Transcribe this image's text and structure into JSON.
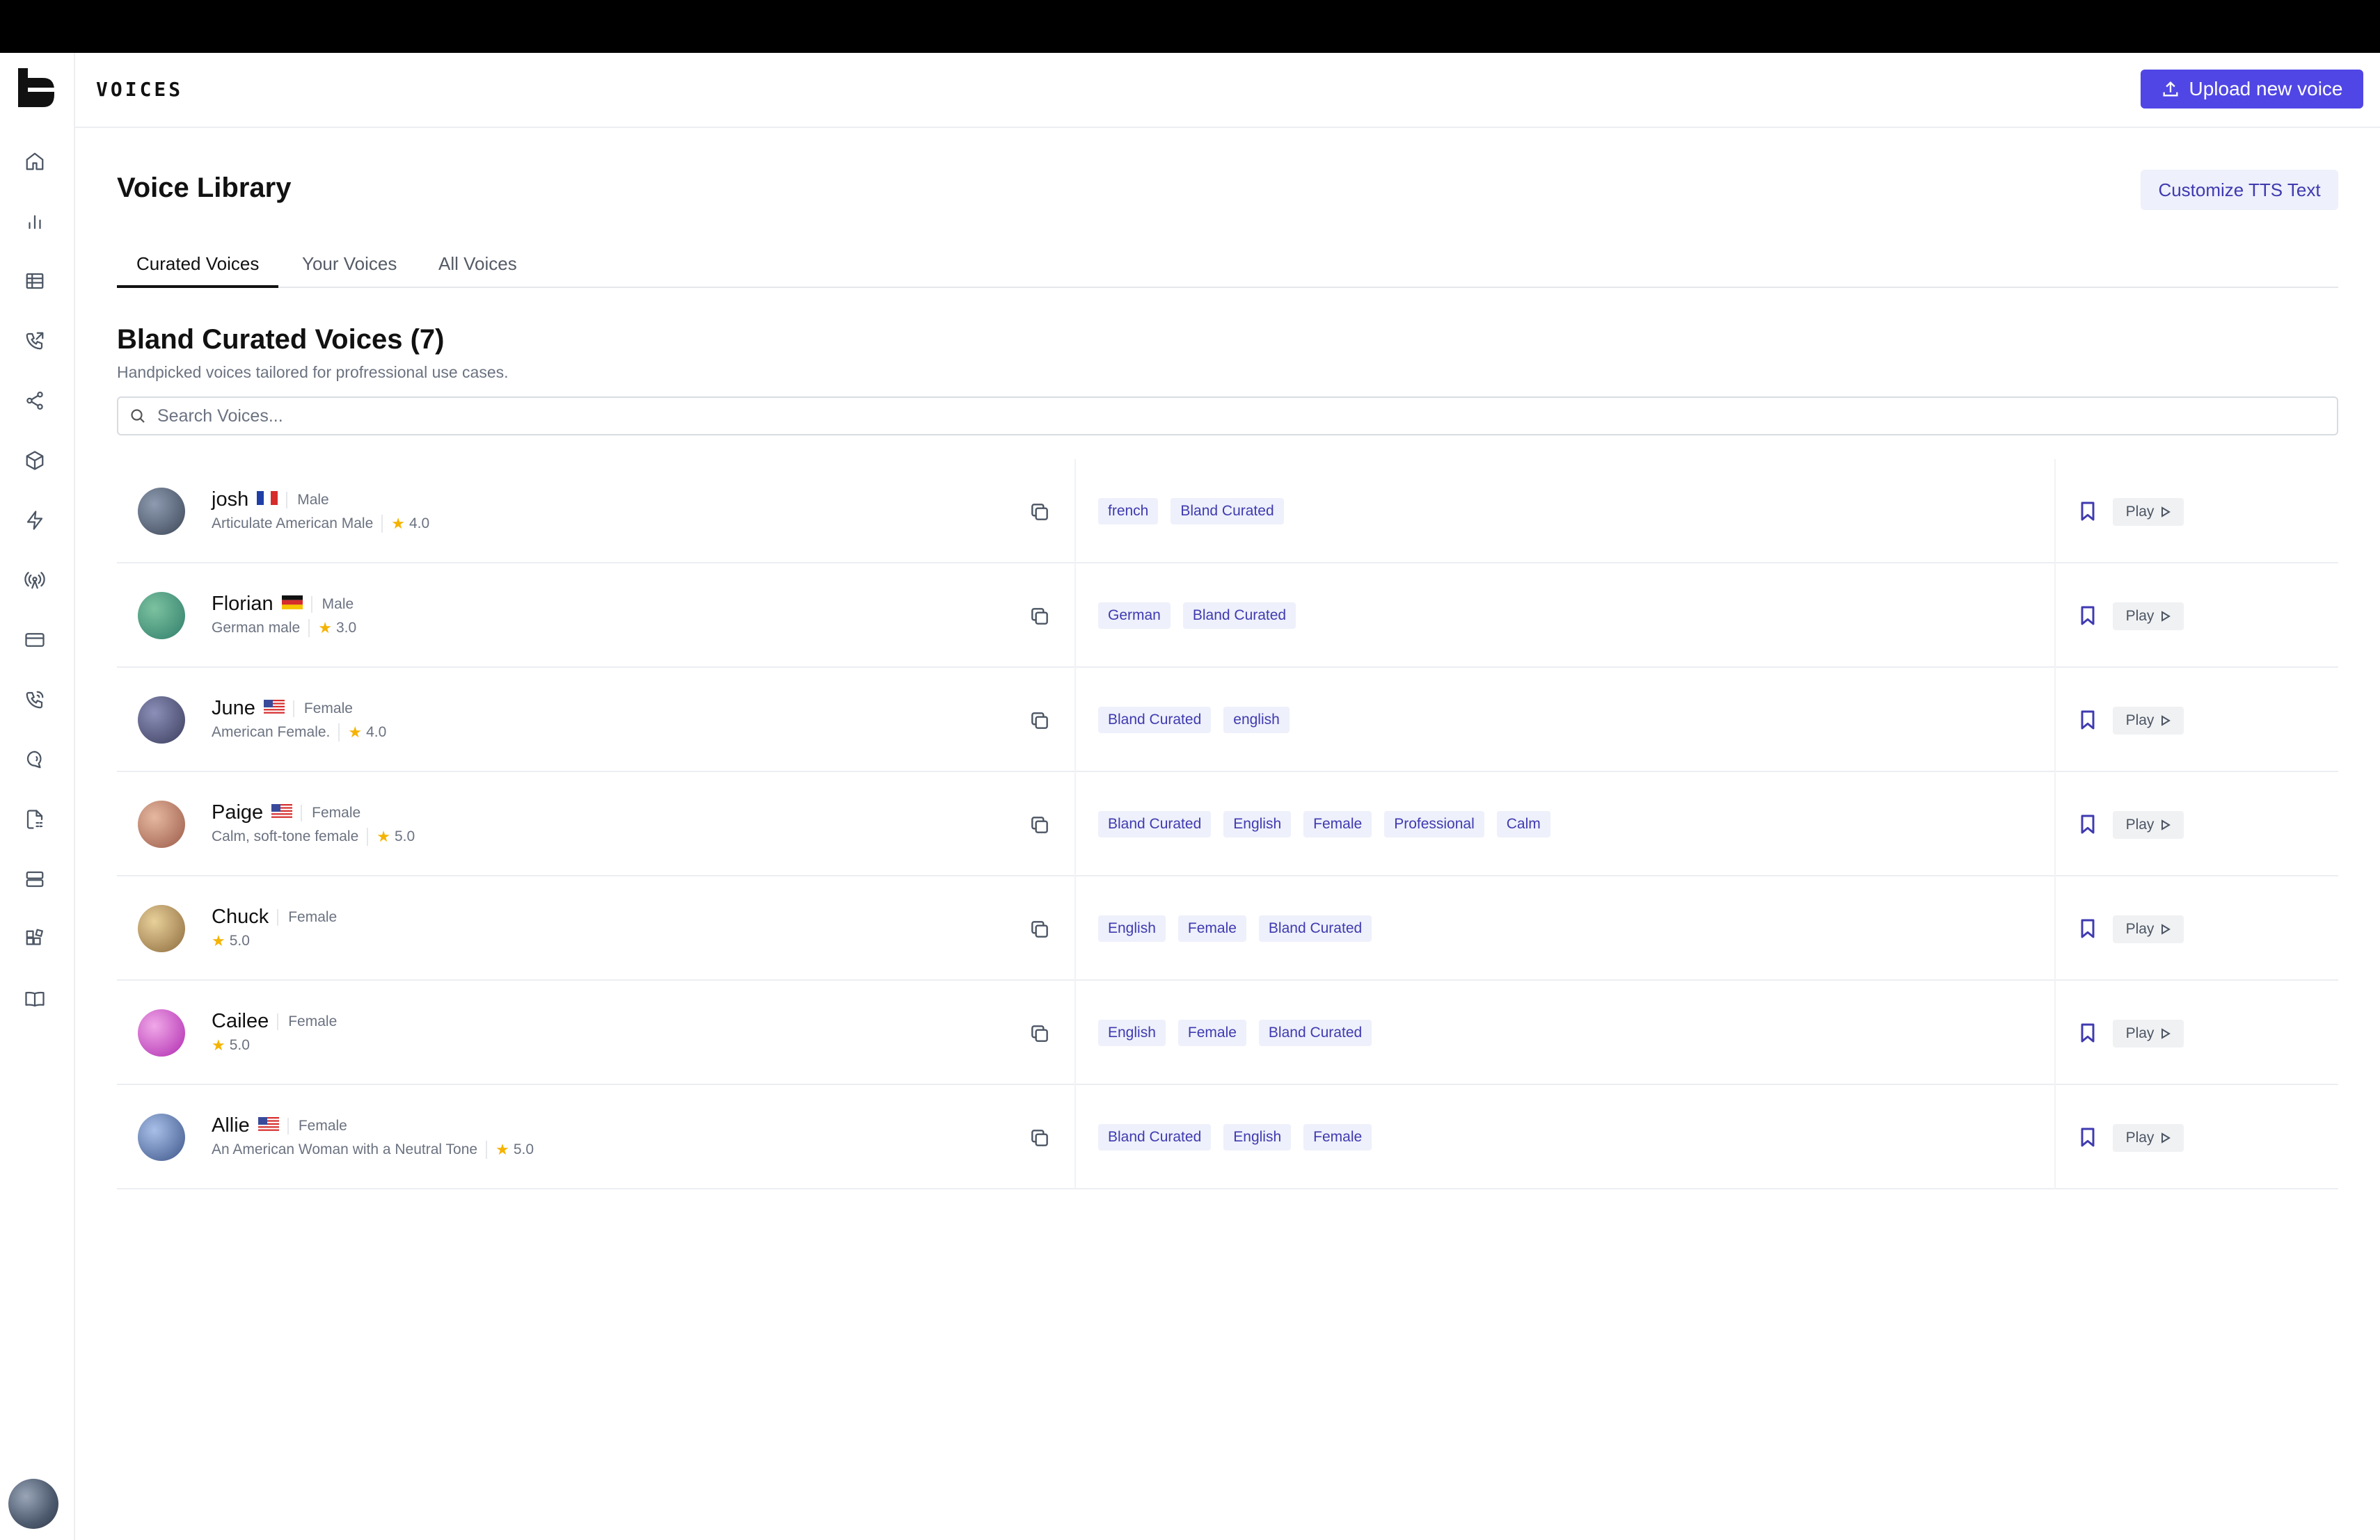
{
  "header": {
    "title": "VOICES",
    "upload_label": "Upload new voice"
  },
  "page": {
    "title": "Voice Library",
    "customize_label": "Customize TTS Text"
  },
  "tabs": [
    {
      "label": "Curated Voices",
      "active": true
    },
    {
      "label": "Your Voices",
      "active": false
    },
    {
      "label": "All Voices",
      "active": false
    }
  ],
  "section": {
    "title": "Bland Curated Voices (7)",
    "subtitle": "Handpicked voices tailored for profressional use cases."
  },
  "search": {
    "placeholder": "Search Voices...",
    "value": ""
  },
  "sidebar": {
    "icons": [
      "home-icon",
      "bar-chart-icon",
      "table-icon",
      "phone-outgoing-icon",
      "share-nodes-icon",
      "box-icon",
      "zap-icon",
      "broadcast-icon",
      "credit-card-icon",
      "phone-call-icon",
      "chat-voice-icon",
      "file-dashed-icon",
      "server-icon",
      "puzzle-blocks-icon",
      "book-open-icon"
    ]
  },
  "play_label": "Play",
  "voices": [
    {
      "name": "josh",
      "flag": "france",
      "gender": "Male",
      "description": "Articulate American Male",
      "rating": "4.0",
      "tags": [
        "french",
        "Bland Curated"
      ],
      "avatar_colors": [
        "#8e9bb0",
        "#3c4658"
      ]
    },
    {
      "name": "Florian",
      "flag": "germany",
      "gender": "Male",
      "description": "German male",
      "rating": "3.0",
      "tags": [
        "German",
        "Bland Curated"
      ],
      "avatar_colors": [
        "#7cc2a0",
        "#2f7d6a"
      ]
    },
    {
      "name": "June",
      "flag": "usa",
      "gender": "Female",
      "description": "American Female.",
      "rating": "4.0",
      "tags": [
        "Bland Curated",
        "english"
      ],
      "avatar_colors": [
        "#8c8fb8",
        "#3a3d5c"
      ]
    },
    {
      "name": "Paige",
      "flag": "usa",
      "gender": "Female",
      "description": "Calm, soft-tone female",
      "rating": "5.0",
      "tags": [
        "Bland Curated",
        "English",
        "Female",
        "Professional",
        "Calm"
      ],
      "avatar_colors": [
        "#e6b8a0",
        "#9a5a48"
      ]
    },
    {
      "name": "Chuck",
      "flag": "",
      "gender": "Female",
      "description": "",
      "rating": "5.0",
      "tags": [
        "English",
        "Female",
        "Bland Curated"
      ],
      "avatar_colors": [
        "#e8d09a",
        "#8c6a3c"
      ]
    },
    {
      "name": "Cailee",
      "flag": "",
      "gender": "Female",
      "description": "",
      "rating": "5.0",
      "tags": [
        "English",
        "Female",
        "Bland Curated"
      ],
      "avatar_colors": [
        "#f0a8e8",
        "#b02ab0"
      ]
    },
    {
      "name": "Allie",
      "flag": "usa",
      "gender": "Female",
      "description": "An American Woman with a Neutral Tone",
      "rating": "5.0",
      "tags": [
        "Bland Curated",
        "English",
        "Female"
      ],
      "avatar_colors": [
        "#a8c0e8",
        "#3c5488"
      ]
    }
  ]
}
